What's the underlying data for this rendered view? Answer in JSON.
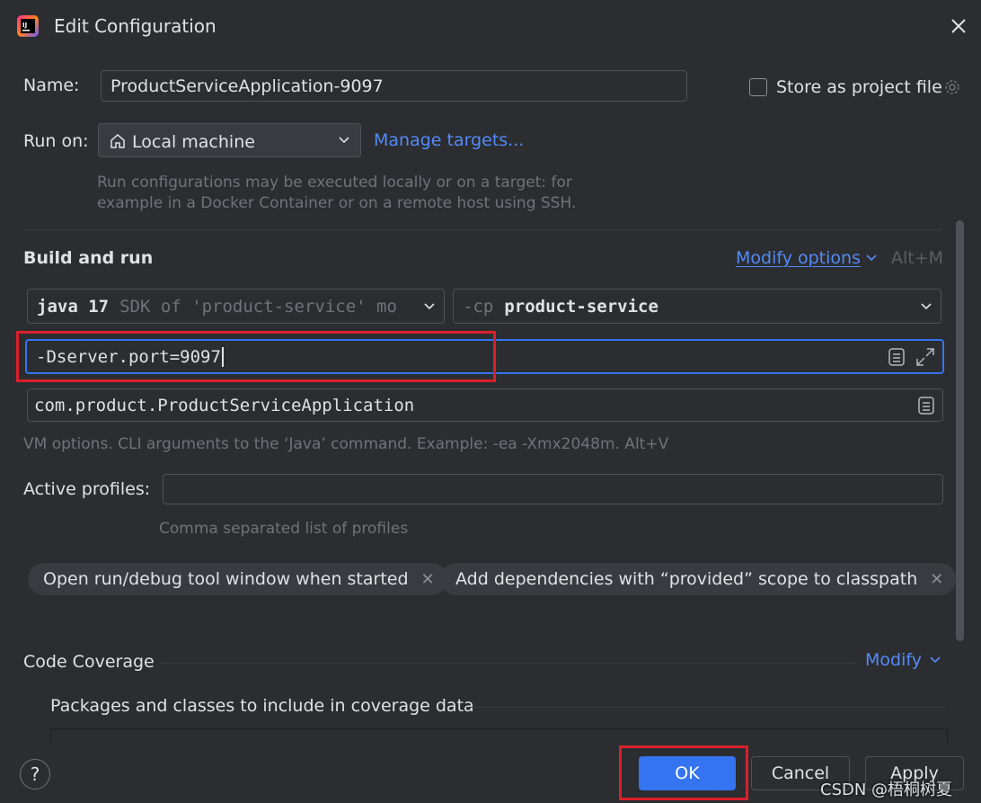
{
  "window": {
    "title": "Edit Configuration"
  },
  "name_row": {
    "label": "Name:",
    "value": "ProductServiceApplication-9097",
    "store_label": "Store as project file"
  },
  "run_on": {
    "label": "Run on:",
    "target": "Local machine",
    "manage_link": "Manage targets...",
    "hint_line1": "Run configurations may be executed locally or on a target: for",
    "hint_line2": "example in a Docker Container or on a remote host using SSH."
  },
  "build_run": {
    "title": "Build and run",
    "modify_options": "Modify options",
    "shortcut": "Alt+M",
    "jdk_bold": "java 17",
    "jdk_rest": "SDK of 'product-service' mo",
    "cp_prefix": "-cp",
    "cp_value": "product-service",
    "vm_options": "-Dserver.port=9097",
    "main_class": "com.product.ProductServiceApplication",
    "vm_hint": "VM options. CLI arguments to the ‘Java’ command. Example: -ea -Xmx2048m. Alt+V"
  },
  "profiles": {
    "label": "Active profiles:",
    "value": "",
    "hint": "Comma separated list of profiles"
  },
  "chips": [
    "Open run/debug tool window when started",
    "Add dependencies with “provided” scope to classpath"
  ],
  "coverage": {
    "title": "Code Coverage",
    "modify": "Modify",
    "packages_label": "Packages and classes to include in coverage data"
  },
  "buttons": {
    "ok": "OK",
    "cancel": "Cancel",
    "apply": "Apply",
    "help": "?"
  },
  "watermark": "CSDN @梧桐树夏",
  "colors": {
    "accent": "#548af7",
    "primary_button": "#3574f0",
    "highlight_box": "#d9212c",
    "background": "#2b2d30"
  }
}
